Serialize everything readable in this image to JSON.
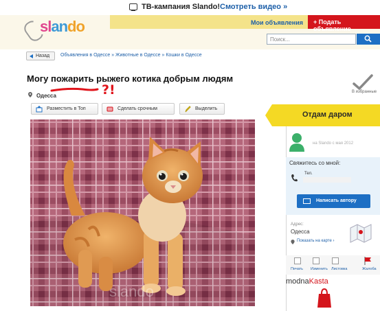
{
  "promo": {
    "campaign": "ТВ-кампания Slando!",
    "watch_video": "Смотреть видео »"
  },
  "header": {
    "logo_part1": "sl",
    "logo_part2": "an",
    "logo_part3": "do",
    "my_ads": "Мои объявления",
    "post_ad": "+ Подать объявление",
    "search_placeholder": "Поиск..."
  },
  "breadcrumb": {
    "back": "Назад",
    "path": "Объявления в Одессе » Животные в Одессе » Кошки в Одессе"
  },
  "listing": {
    "title": "Могу пожарить рыжего котика добрым людям",
    "city": "Одесса",
    "scribble": "?!",
    "btn_top": "Разместить в Топ",
    "btn_urgent": "Сделать срочным",
    "btn_highlight": "Выделить",
    "favorite": "В избранные",
    "watermark": "slando"
  },
  "sidebar": {
    "giveaway": "Отдам даром",
    "since": "на Slando с мая 2012",
    "contact_label": "Свяжитесь со мной:",
    "tel_label": "Тел.",
    "write_author": "Написать автору",
    "address_label": "Адрес:",
    "address": "Одесса",
    "show_map": "Показать на карте ›",
    "tools": [
      "Печать",
      "Изменить",
      "Листовка",
      "Жалоба"
    ],
    "promo_brand_1": "modna",
    "promo_brand_2": "Kasta"
  },
  "colors": {
    "accent_red": "#d4151c",
    "link_blue": "#1d5fa8",
    "button_blue": "#1d6fc4",
    "giveaway_yellow": "#f4d924",
    "header_yellow": "#f4e38a",
    "user_green": "#3bb06a"
  },
  "icons": {
    "tv": "tv-icon",
    "paperclip": "paperclip-icon",
    "search": "search-icon",
    "back": "arrow-left-icon",
    "location": "location-pin-icon",
    "top": "top-ad-icon",
    "urgent": "urgent-icon",
    "highlight": "highlight-icon",
    "favorite": "checkmark-icon",
    "user": "user-icon",
    "phone": "phone-icon",
    "envelope": "envelope-icon",
    "map": "map-icon",
    "print": "print-icon",
    "edit": "edit-icon",
    "leaflet": "leaflet-icon",
    "complaint": "flag-icon"
  }
}
